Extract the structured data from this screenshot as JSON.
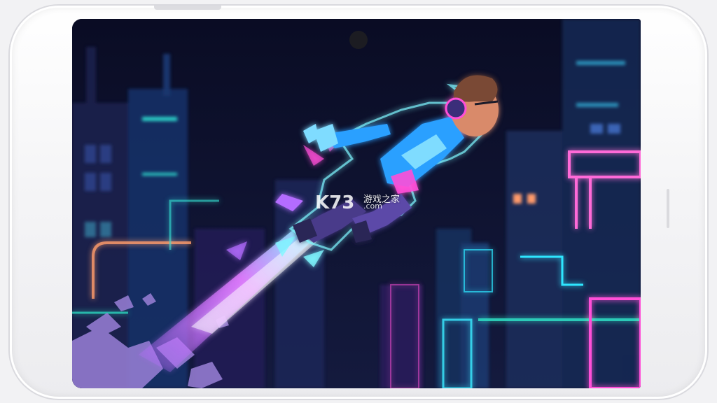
{
  "device": {
    "type": "phone-landscape-mockup",
    "frame_color": "#f4f4f6"
  },
  "scene": {
    "title": "",
    "character": "jetpack-runner-hero",
    "setting": "neon-cyberpunk-city-night",
    "palette": {
      "sky": "#0a0e28",
      "neon_cyan": "#38e8ff",
      "neon_pink": "#ff4fd8",
      "neon_purple": "#b46cff",
      "suit_blue": "#2aa0ff"
    }
  },
  "watermark": {
    "logo": "K73",
    "text": "游戏之家",
    "domain": ".com"
  }
}
